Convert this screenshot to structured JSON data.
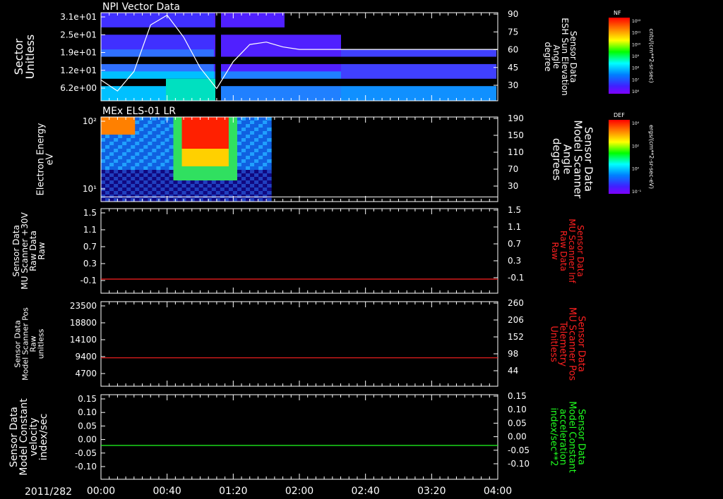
{
  "date_label": "2011/282",
  "x_ticks": [
    "00:00",
    "00:40",
    "01:20",
    "02:00",
    "02:40",
    "03:20",
    "04:00"
  ],
  "colors": {
    "white": "#ffffff",
    "red": "#ff2020",
    "green": "#20ff20",
    "black": "#000000"
  },
  "colorbars": [
    {
      "title": "NF",
      "units": "cnts/(cm**2-sr-sec)",
      "ticks": [
        "10¹²",
        "10¹¹",
        "10¹⁰",
        "10⁹",
        "10⁸",
        "10⁷",
        "10⁶"
      ]
    },
    {
      "title": "DEF",
      "units": "ergs/(cm**2-sr-sec-eV)",
      "ticks": [
        "10⁴",
        "10²",
        "10⁰",
        "10⁻¹"
      ]
    }
  ],
  "panels": [
    {
      "title": "NPI Vector Data",
      "left_label": [
        "Sector",
        "Unitless"
      ],
      "left_ticks": [
        "3.1e+01",
        "2.5e+01",
        "1.9e+01",
        "1.2e+01",
        "6.2e+00"
      ],
      "right_label": [
        "Sensor Data",
        "ESH Sun Elevation",
        "Angle",
        "degree"
      ],
      "right_ticks": [
        "90",
        "75",
        "60",
        "45",
        "30"
      ]
    },
    {
      "title": "MEx ELS-01 LR",
      "left_label": [
        "Electron Energy",
        "eV"
      ],
      "left_ticks": [
        "10²",
        "10¹"
      ],
      "right_label": [
        "Sensor Data",
        "Model Scanner",
        "Angle",
        "degrees"
      ],
      "right_ticks": [
        "190",
        "150",
        "110",
        "70",
        "30"
      ]
    },
    {
      "title": "",
      "left_label": [
        "Sensor Data",
        "MU Scanner +30V",
        "Raw Data",
        "Raw"
      ],
      "left_ticks": [
        "1.5",
        "1.1",
        "0.7",
        "0.3",
        "-0.1"
      ],
      "right_label": [
        "Sensor Data",
        "MU Scanner Inf",
        "Raw Data",
        "Raw"
      ],
      "right_ticks": [
        "1.5",
        "1.1",
        "0.7",
        "0.3",
        "-0.1"
      ]
    },
    {
      "title": "",
      "left_label": [
        "Sensor Data",
        "Model Scanner Pos",
        "Raw",
        "unitless"
      ],
      "left_ticks": [
        "23500",
        "18800",
        "14100",
        "9400",
        "4700"
      ],
      "right_label": [
        "Sensor Data",
        "MU Scanner Pos",
        "Telemetry",
        "Unitless"
      ],
      "right_ticks": [
        "260",
        "206",
        "152",
        "98",
        "44"
      ]
    },
    {
      "title": "",
      "left_label": [
        "Sensor Data",
        "Model Constant",
        "velocity",
        "index/sec"
      ],
      "left_ticks": [
        "0.15",
        "0.10",
        "0.05",
        "0.00",
        "-0.05",
        "-0.10"
      ],
      "right_label": [
        "Sensor Data",
        "Model Constant",
        "acceleration",
        "index/sec**2"
      ],
      "right_ticks": [
        "0.15",
        "0.10",
        "0.05",
        "0.00",
        "-0.05",
        "-0.10"
      ]
    }
  ],
  "chart_data": [
    {
      "type": "heatmap",
      "title": "NPI Vector Data",
      "xlabel": "",
      "ylabel": "Sector Unitless",
      "x_range": [
        "00:00",
        "04:00"
      ],
      "ylim": [
        0,
        31
      ],
      "line_series": {
        "name": "ESH Sun Elevation Angle",
        "y_units": "degree",
        "ylim": [
          18,
          90
        ],
        "x": [
          "00:00",
          "00:10",
          "00:20",
          "00:30",
          "00:40",
          "00:50",
          "01:00",
          "01:10",
          "01:20",
          "01:30",
          "01:40",
          "01:50",
          "02:00",
          "04:00"
        ],
        "values": [
          35,
          26,
          42,
          80,
          88,
          70,
          45,
          28,
          50,
          64,
          66,
          62,
          60,
          60
        ]
      }
    },
    {
      "type": "heatmap",
      "title": "MEx ELS-01 LR",
      "xlabel": "",
      "ylabel": "Electron Energy eV",
      "x_range": [
        "00:00",
        "04:00"
      ],
      "yscale": "log",
      "data_until": "01:43",
      "line_series": {
        "name": "Model Scanner Angle",
        "y_units": "degrees",
        "ylim": [
          10,
          190
        ],
        "values_constant": 20
      }
    },
    {
      "type": "line",
      "title": "",
      "ylabel": "Sensor Data MU Scanner +30V Raw Data Raw",
      "ylim": [
        -0.3,
        1.5
      ],
      "series": [
        {
          "name": "MU Scanner +30V",
          "x": [
            "00:00",
            "04:00"
          ],
          "values": [
            0.0,
            0.0
          ]
        }
      ]
    },
    {
      "type": "line",
      "title": "",
      "ylabel": "Sensor Data Model Scanner Pos Raw unitless",
      "ylim": [
        0,
        23500
      ],
      "series": [
        {
          "name": "MU Scanner Pos Telemetry",
          "x": [
            "00:00",
            "04:00"
          ],
          "values": [
            7900,
            7900
          ]
        }
      ]
    },
    {
      "type": "line",
      "title": "",
      "ylabel": "Sensor Data Model Constant velocity index/sec",
      "ylim": [
        -0.1,
        0.15
      ],
      "series": [
        {
          "name": "Model Constant acceleration",
          "x": [
            "00:00",
            "04:00"
          ],
          "values": [
            0.0,
            0.0
          ]
        }
      ]
    }
  ]
}
